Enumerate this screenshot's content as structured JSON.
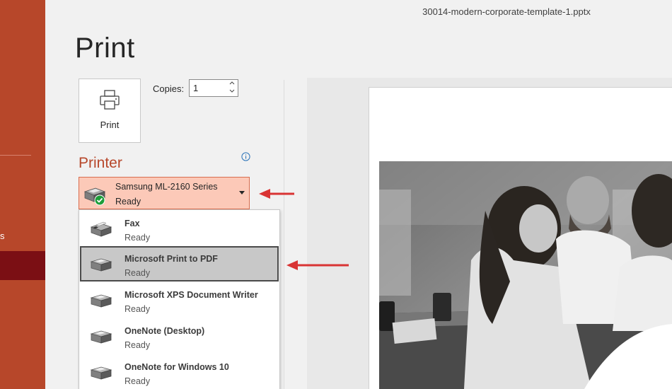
{
  "window": {
    "file_name": "30014-modern-corporate-template-1.pptx"
  },
  "backstage": {
    "partial_label": "s"
  },
  "page": {
    "title": "Print"
  },
  "print_button": {
    "label": "Print",
    "icon": "printer-icon"
  },
  "copies": {
    "label": "Copies:",
    "value": "1"
  },
  "printer": {
    "heading": "Printer",
    "selected": {
      "name": "Samsung ML-2160 Series",
      "status": "Ready",
      "icon": "printer-ready-icon"
    },
    "options": [
      {
        "name": "Fax",
        "status": "Ready",
        "icon": "fax-icon"
      },
      {
        "name": "Microsoft Print to PDF",
        "status": "Ready",
        "icon": "printer-icon",
        "highlighted": true
      },
      {
        "name": "Microsoft XPS Document Writer",
        "status": "Ready",
        "icon": "printer-icon"
      },
      {
        "name": "OneNote (Desktop)",
        "status": "Ready",
        "icon": "printer-icon"
      },
      {
        "name": "OneNote for Windows 10",
        "status": "Ready",
        "icon": "printer-icon"
      }
    ]
  },
  "colors": {
    "accent": "#b7472a",
    "backstage_active": "#7b0f14",
    "selected_printer_bg": "#fcc9b8",
    "annotation_arrow": "#d93434"
  }
}
